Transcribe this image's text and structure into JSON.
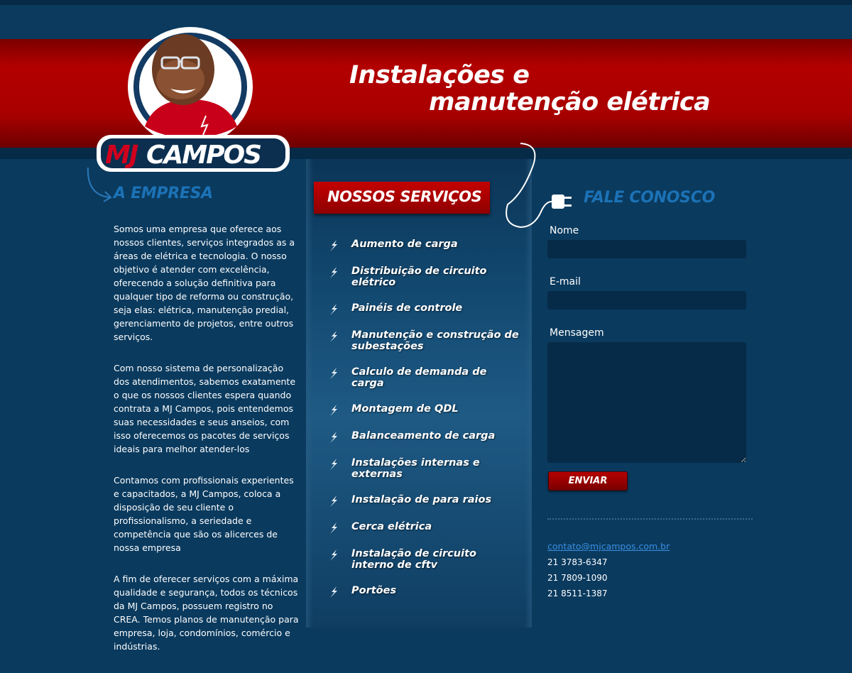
{
  "header": {
    "slogan_line1": "Instalações e",
    "slogan_line2": "manutenção elétrica",
    "logo_text": "MJCAMPOS",
    "logo_icon": "mascot-logo-icon"
  },
  "about": {
    "title": "A EMPRESA",
    "paragraphs": [
      "Somos uma empresa que oferece aos nossos clientes, serviços integrados as a áreas de elétrica e tecnologia. O nosso objetivo é atender com excelência, oferecendo a solução definitiva para qualquer tipo de reforma ou construção, seja elas: elétrica, manutenção predial, gerenciamento de projetos, entre outros serviços.",
      "Com nosso sistema de personalização dos atendimentos, sabemos exatamente o que os nossos clientes espera quando contrata a MJ Campos, pois entendemos suas necessidades e seus anseios, com isso oferecemos os pacotes de serviços ideais para melhor atender-los",
      "Contamos com profissionais experientes e capacitados, a MJ Campos, coloca a disposição de seu cliente o profissionalismo, a seriedade e competência que são os alicerces de nossa empresa",
      "A fim de oferecer serviços com a máxima qualidade e segurança, todos os técnicos da MJ Campos, possuem registro no CREA. Temos planos de manutenção para empresa, loja, condomínios, comércio e indústrias."
    ]
  },
  "services": {
    "title": "NOSSOS SERVIÇOS",
    "items": [
      "Aumento de carga",
      "Distribuição de circuito elétrico",
      "Painéis de controle",
      "Manutenção e construção de subestações",
      "Calculo de demanda de carga",
      "Montagem de QDL",
      "Balanceamento de carga",
      "Instalações internas e externas",
      "Instalação de para raios",
      "Cerca elétrica",
      "Instalação de circuito interno de cftv",
      "Portões"
    ]
  },
  "contact": {
    "title": "FALE CONOSCO",
    "name_label": "Nome",
    "email_label": "E-mail",
    "message_label": "Mensagem",
    "send_label": "ENVIAR",
    "email": "contato@mjcampos.com.br",
    "phones": [
      "21 3783-6347",
      "21 7809-1090",
      "21 8511-1387"
    ]
  },
  "colors": {
    "background": "#0a3a5e",
    "banner_red": "#b30000",
    "title_blue": "#1c72b6",
    "link_blue": "#3a8ee0"
  }
}
